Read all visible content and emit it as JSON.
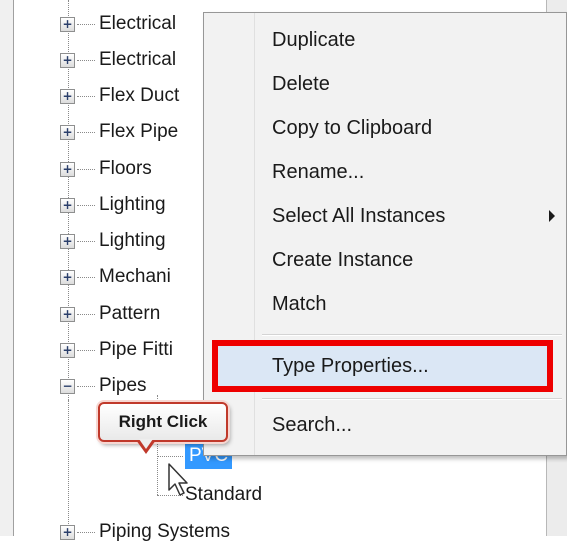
{
  "tree": {
    "items": [
      {
        "label": "Electrical",
        "expander": "+"
      },
      {
        "label": "Electrical",
        "expander": "+"
      },
      {
        "label": "Flex Duct",
        "expander": "+"
      },
      {
        "label": "Flex Pipe",
        "expander": "+"
      },
      {
        "label": "Floors",
        "expander": "+"
      },
      {
        "label": "Lighting",
        "expander": "+"
      },
      {
        "label": "Lighting",
        "expander": "+"
      },
      {
        "label": "Mechani",
        "expander": "+"
      },
      {
        "label": "Pattern",
        "expander": "+"
      },
      {
        "label": "Pipe Fitti",
        "expander": "+"
      },
      {
        "label": "Pipes",
        "expander": "−"
      },
      {
        "label": "Piping Systems",
        "expander": "+"
      }
    ],
    "pipes_children": [
      {
        "label": "PVC",
        "selected": true
      },
      {
        "label": "Standard",
        "selected": false
      }
    ]
  },
  "context_menu": {
    "items": [
      {
        "label": "Duplicate"
      },
      {
        "label": "Delete"
      },
      {
        "label": "Copy to Clipboard"
      },
      {
        "label": "Rename..."
      },
      {
        "label": "Select All Instances",
        "has_submenu": true
      },
      {
        "label": "Create Instance"
      },
      {
        "label": "Match"
      },
      {
        "label": "Type Properties...",
        "highlighted": true
      },
      {
        "label": "Search..."
      }
    ]
  },
  "callout": {
    "text": "Right Click"
  },
  "icons": [
    "expander-plus-icon",
    "expander-minus-icon",
    "submenu-arrow-icon",
    "mouse-pointer-icon"
  ],
  "colors": {
    "highlight_outline": "#ee0000",
    "selection": "#3399ff",
    "menu_bg": "#f2f2f2"
  }
}
